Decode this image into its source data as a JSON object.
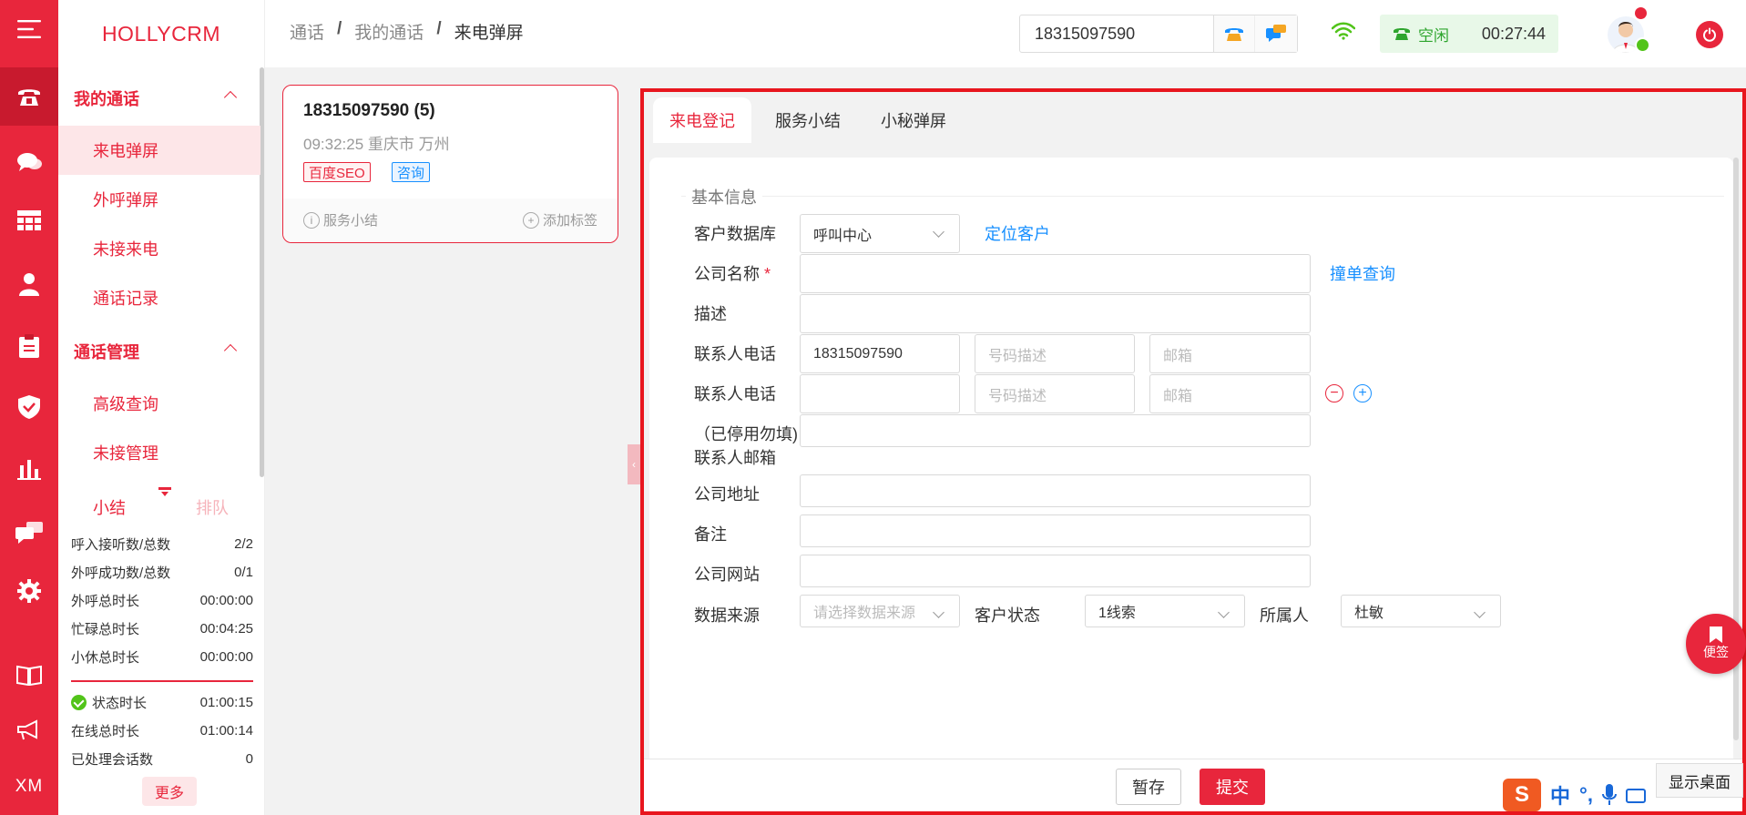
{
  "app": {
    "brand": "HOLLYCRM"
  },
  "rail": {
    "bottom_label": "XM"
  },
  "sidebar": {
    "group1": {
      "label": "我的通话",
      "items": [
        "来电弹屏",
        "外呼弹屏",
        "未接来电",
        "通话记录"
      ]
    },
    "group2": {
      "label": "通话管理",
      "items": [
        "高级查询",
        "未接管理"
      ]
    },
    "summary_tab": "小结",
    "queue_tab": "排队",
    "stats": [
      {
        "label": "呼入接听数/总数",
        "value": "2/2"
      },
      {
        "label": "外呼成功数/总数",
        "value": "0/1"
      },
      {
        "label": "外呼总时长",
        "value": "00:00:00"
      },
      {
        "label": "忙碌总时长",
        "value": "00:04:25"
      },
      {
        "label": "小休总时长",
        "value": "00:00:00"
      }
    ],
    "stats2": [
      {
        "label": "状态时长",
        "value": "01:00:15"
      },
      {
        "label": "在线总时长",
        "value": "01:00:14"
      },
      {
        "label": "已处理会话数",
        "value": "0"
      }
    ],
    "more": "更多"
  },
  "header": {
    "breadcrumb": [
      "通话",
      "我的通话",
      "来电弹屏"
    ],
    "phone": "18315097590",
    "status": "空闲",
    "timer": "00:27:44"
  },
  "call": {
    "number": "18315097590 (5)",
    "meta": "09:32:25 重庆市 万州",
    "tags": [
      "百度SEO",
      "咨询"
    ],
    "summary": "服务小结",
    "add_tag": "添加标签"
  },
  "tabs": [
    "来电登记",
    "服务小结",
    "小秘弹屏"
  ],
  "form": {
    "section": "基本信息",
    "customer_db_label": "客户数据库",
    "customer_db_value": "呼叫中心",
    "locate": "定位客户",
    "company_label": "公司名称",
    "required_mark": "*",
    "dup_query": "撞单查询",
    "desc_label": "描述",
    "phone_label": "联系人电话",
    "phone1": "18315097590",
    "phone_desc_ph": "号码描述",
    "email_ph": "邮箱",
    "email_label_1": "（已停用勿填)",
    "email_label_2": "联系人邮箱",
    "address_label": "公司地址",
    "remark_label": "备注",
    "website_label": "公司网站",
    "source_label": "数据来源",
    "source_ph": "请选择数据来源",
    "cust_status_label": "客户状态",
    "cust_status_value": "1线索",
    "owner_label": "所属人",
    "owner_value": "杜敏"
  },
  "footer": {
    "save": "暂存",
    "submit": "提交"
  },
  "note_fab": "便签",
  "desktop_tip": "显示桌面",
  "ime": {
    "logo": "S",
    "mode": "中"
  },
  "colors": {
    "primary": "#e8263c",
    "link": "#1890ff",
    "success": "#52c41a"
  }
}
